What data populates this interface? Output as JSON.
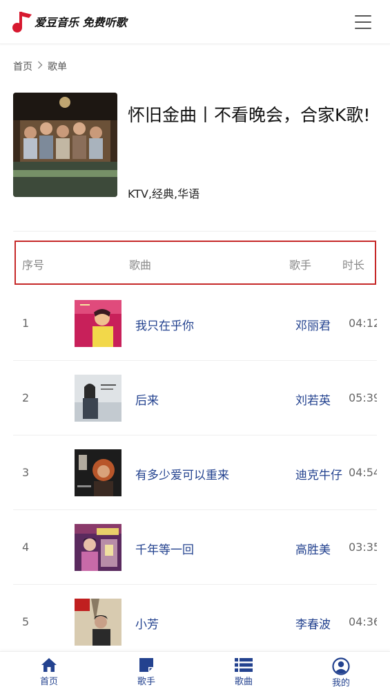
{
  "header": {
    "logo_text": "爱豆音乐 免费听歌",
    "logo_icon": "music-note-icon",
    "menu_icon": "hamburger-menu-icon"
  },
  "breadcrumb": {
    "home": "首页",
    "current": "歌单"
  },
  "playlist": {
    "title": "怀旧金曲丨不看晚会，合家K歌!",
    "tags": "KTV,经典,华语"
  },
  "table": {
    "headers": {
      "index": "序号",
      "song": "歌曲",
      "singer": "歌手",
      "duration": "时长"
    },
    "rows": [
      {
        "index": "1",
        "song": "我只在乎你",
        "singer": "邓丽君",
        "duration": "04:12"
      },
      {
        "index": "2",
        "song": "后来",
        "singer": "刘若英",
        "duration": "05:39"
      },
      {
        "index": "3",
        "song": "有多少爱可以重来",
        "singer": "迪克牛仔",
        "duration": "04:54"
      },
      {
        "index": "4",
        "song": "千年等一回",
        "singer": "高胜美",
        "duration": "03:35"
      },
      {
        "index": "5",
        "song": "小芳",
        "singer": "李春波",
        "duration": "04:36"
      }
    ]
  },
  "bottom_nav": {
    "items": [
      {
        "label": "首页",
        "icon": "home-icon"
      },
      {
        "label": "歌手",
        "icon": "singer-icon"
      },
      {
        "label": "歌曲",
        "icon": "list-icon"
      },
      {
        "label": "我的",
        "icon": "user-icon"
      }
    ]
  },
  "colors": {
    "accent": "#23428f",
    "brand_red": "#d7192f",
    "highlight_border": "#c62828"
  }
}
